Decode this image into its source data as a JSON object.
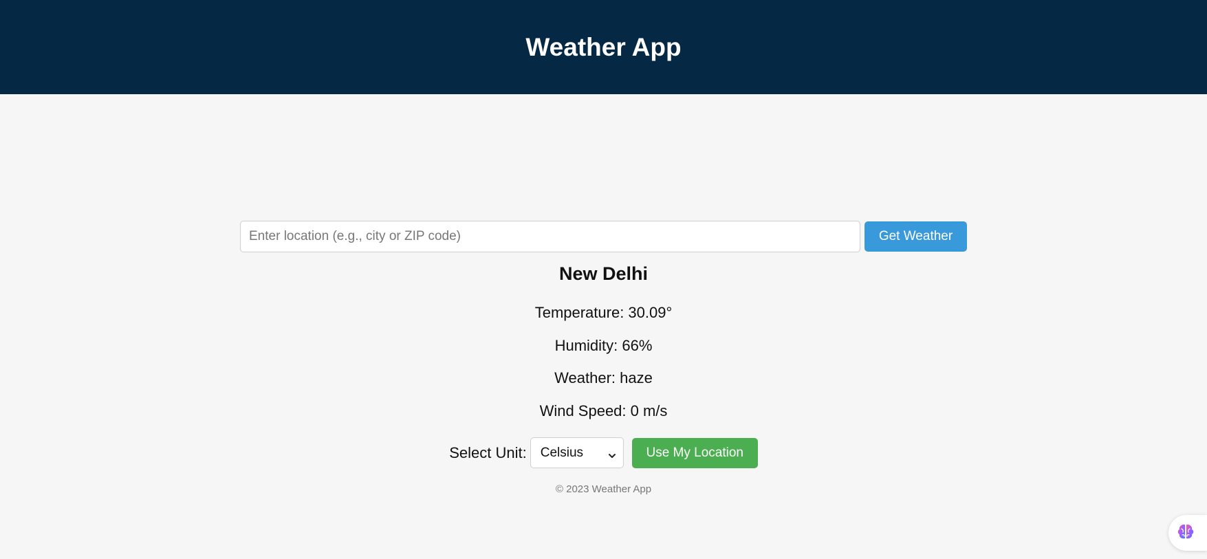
{
  "header": {
    "title": "Weather App",
    "background": "#052945"
  },
  "search": {
    "placeholder": "Enter location (e.g., city or ZIP code)",
    "value": "",
    "button_label": "Get Weather",
    "button_color": "#3899db"
  },
  "result": {
    "city": "New Delhi",
    "temperature": "Temperature: 30.09°",
    "humidity": "Humidity: 66%",
    "weather": "Weather: haze",
    "wind_speed": "Wind Speed: 0 m/s"
  },
  "controls": {
    "unit_label": "Select Unit:",
    "unit_selected": "Celsius",
    "location_button_label": "Use My Location",
    "location_button_color": "#4bae50"
  },
  "footer": {
    "text": "© 2023 Weather App"
  },
  "extension_widget": {
    "icon": "brain-icon"
  }
}
